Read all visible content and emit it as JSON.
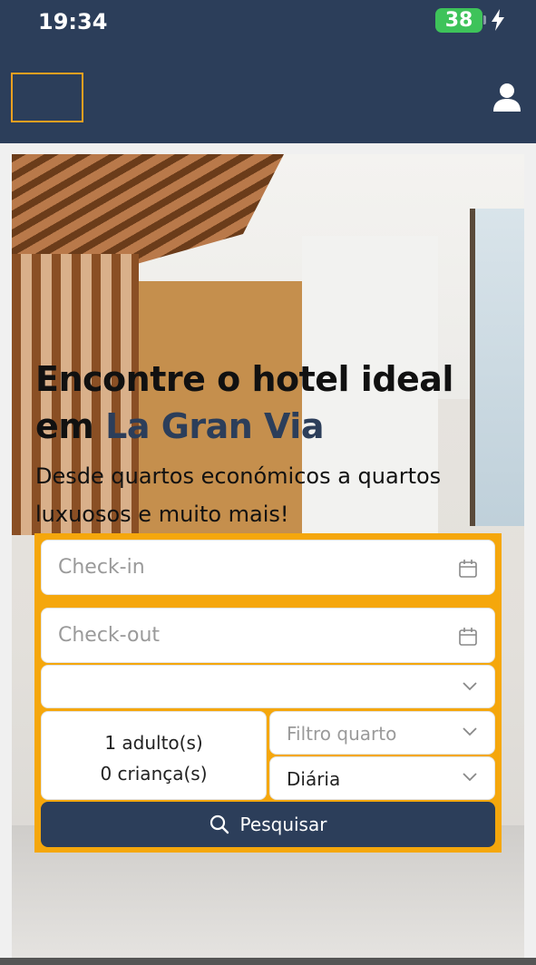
{
  "status_bar": {
    "time": "19:34",
    "battery": "38"
  },
  "header": {
    "logo": "",
    "user_icon": "user-icon"
  },
  "hero": {
    "title_line1": "Encontre o hotel ideal",
    "title_line2_prefix": "em ",
    "title_highlight": "La Gran Via",
    "subtitle": "Desde quartos económicos a quartos luxuosos e muito mais!"
  },
  "search": {
    "checkin_placeholder": "Check-in",
    "checkout_placeholder": "Check-out",
    "hotel_select_value": "",
    "guests_adults": "1 adulto(s)",
    "guests_children": "0 criança(s)",
    "room_filter_placeholder": "Filtro quarto",
    "rate_type_value": "Diária",
    "search_button_label": "Pesquisar"
  },
  "colors": {
    "header_bg": "#2c3e5a",
    "accent": "#f5a70c",
    "highlight": "#2c3e5a",
    "battery": "#3ec35a"
  }
}
